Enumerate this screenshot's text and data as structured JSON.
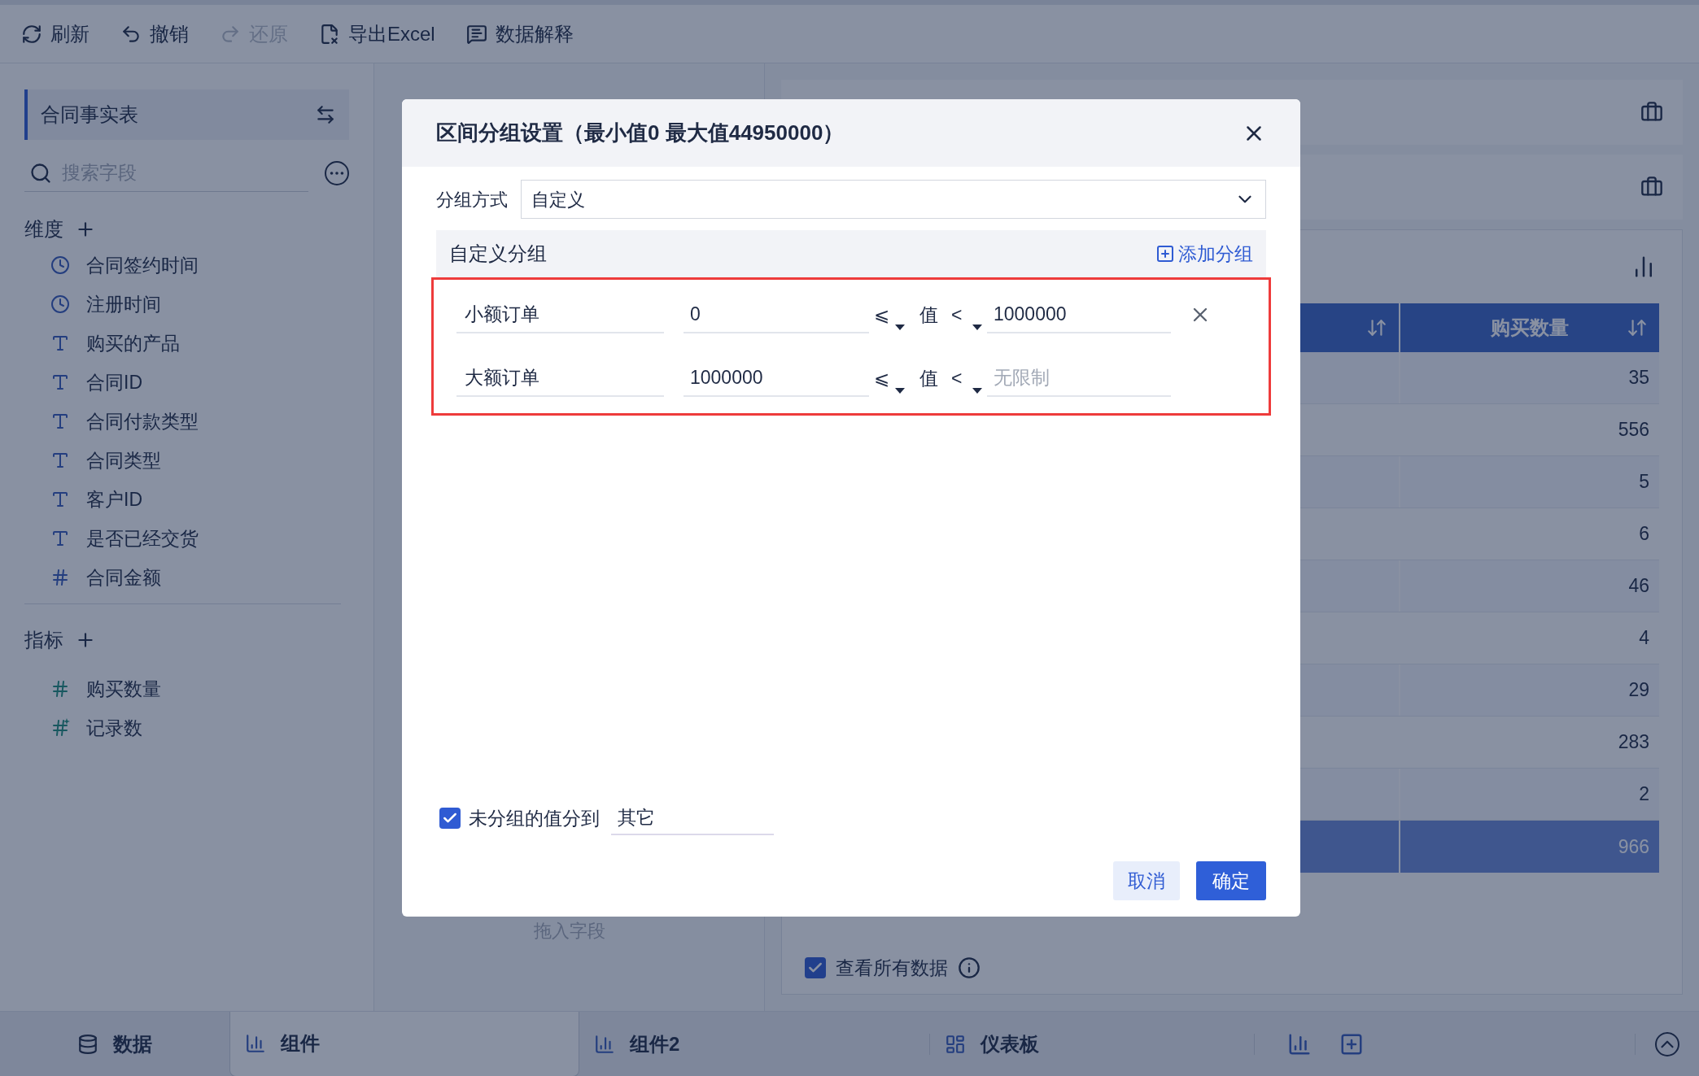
{
  "toolbar": [
    {
      "label": "刷新",
      "disabled": false
    },
    {
      "label": "撤销",
      "disabled": false
    },
    {
      "label": "还原",
      "disabled": true
    },
    {
      "label": "导出Excel",
      "disabled": false
    },
    {
      "label": "数据解释",
      "disabled": false
    }
  ],
  "sidebar": {
    "table_name": "合同事实表",
    "search": {
      "placeholder": "搜索字段"
    },
    "dimensions": {
      "title": "维度",
      "fields": [
        {
          "name": "合同签约时间",
          "kind": "date"
        },
        {
          "name": "注册时间",
          "kind": "date"
        },
        {
          "name": "购买的产品",
          "kind": "text"
        },
        {
          "name": "合同ID",
          "kind": "text"
        },
        {
          "name": "合同付款类型",
          "kind": "text"
        },
        {
          "name": "合同类型",
          "kind": "text"
        },
        {
          "name": "客户ID",
          "kind": "text"
        },
        {
          "name": "是否已经交货",
          "kind": "text"
        },
        {
          "name": "合同金额",
          "kind": "number"
        }
      ]
    },
    "measures": {
      "title": "指标",
      "fields": [
        {
          "name": "购买数量",
          "kind": "number"
        },
        {
          "name": "记录数",
          "kind": "count"
        }
      ]
    }
  },
  "middle": {
    "drop_hint": "拖入字段"
  },
  "table": {
    "header": "购买数量",
    "rows": [
      "35",
      "556",
      "5",
      "6",
      "46",
      "4",
      "29",
      "283",
      "2"
    ],
    "total": "966"
  },
  "view_all": {
    "label": "查看所有数据",
    "checked": true
  },
  "dialog": {
    "title": "区间分组设置（最小值0 最大值44950000）",
    "method_label": "分组方式",
    "method": "自定义",
    "section_title": "自定义分组",
    "add_label": "添加分组",
    "groups": [
      {
        "name": "小额订单",
        "min": "0",
        "lower_op": "⩽",
        "value_label": "值",
        "upper_op": "<",
        "max": "1000000",
        "removable": true
      },
      {
        "name": "大额订单",
        "min": "1000000",
        "lower_op": "⩽",
        "value_label": "值",
        "upper_op": "<",
        "max_placeholder": "无限制",
        "removable": false
      }
    ],
    "ungrouped": {
      "checked": true,
      "label": "未分组的值分到",
      "value": "其它"
    },
    "cancel": "取消",
    "ok": "确定"
  },
  "bottom_tabs": [
    {
      "label": "数据",
      "selected": false
    },
    {
      "label": "组件",
      "selected": true
    },
    {
      "label": "组件2",
      "selected": false
    },
    {
      "label": "仪表板",
      "selected": false
    }
  ]
}
